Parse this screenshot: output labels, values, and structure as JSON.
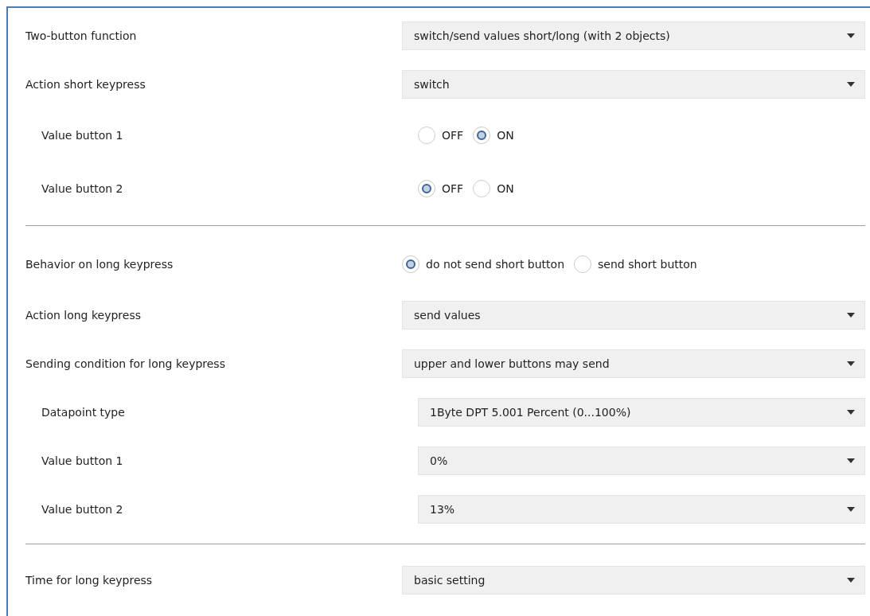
{
  "sections": [
    {
      "rows": [
        {
          "kind": "dropdown",
          "label": "Two-button function",
          "value": "switch/send values short/long (with 2 objects)"
        },
        {
          "kind": "dropdown",
          "label": "Action short keypress",
          "value": "switch",
          "children": [
            {
              "kind": "radio",
              "label": "Value button 1",
              "options": [
                {
                  "label": "OFF",
                  "selected": false
                },
                {
                  "label": "ON",
                  "selected": true
                }
              ]
            },
            {
              "kind": "radio",
              "label": "Value button 2",
              "options": [
                {
                  "label": "OFF",
                  "selected": true
                },
                {
                  "label": "ON",
                  "selected": false
                }
              ]
            }
          ]
        }
      ]
    },
    {
      "rows": [
        {
          "kind": "radio",
          "label": "Behavior on long keypress",
          "options": [
            {
              "label": "do not send short button",
              "selected": true
            },
            {
              "label": "send short button",
              "selected": false
            }
          ]
        },
        {
          "kind": "dropdown",
          "label": "Action long keypress",
          "value": "send values"
        },
        {
          "kind": "dropdown",
          "label": "Sending condition for long keypress",
          "value": "upper and lower buttons may send",
          "children": [
            {
              "kind": "dropdown",
              "label": "Datapoint type",
              "value": "1Byte DPT 5.001 Percent (0...100%)"
            },
            {
              "kind": "dropdown",
              "label": "Value button 1",
              "value": "0%"
            },
            {
              "kind": "dropdown",
              "label": "Value button 2",
              "value": "13%"
            }
          ]
        }
      ]
    },
    {
      "rows": [
        {
          "kind": "dropdown",
          "label": "Time for long keypress",
          "value": "basic setting"
        }
      ]
    }
  ]
}
